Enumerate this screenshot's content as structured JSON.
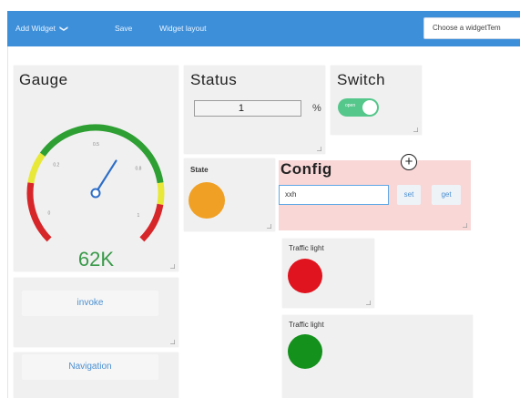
{
  "toolbar": {
    "add_widget_label": "Add Widget",
    "add_widget_chevron": "❯",
    "save_label": "Save",
    "widget_layout_label": "Widget layout",
    "template_placeholder": "Choose a widgetTem"
  },
  "gauge": {
    "title": "Gauge",
    "value_text": "62K",
    "tick_labels": [
      "0",
      "0.2",
      "0.5",
      "0.8",
      "1"
    ],
    "value_fraction": 0.62
  },
  "status": {
    "title": "Status",
    "value": "1",
    "unit": "%"
  },
  "switch": {
    "title": "Switch",
    "state_text": "open",
    "is_on": true
  },
  "state": {
    "title": "State",
    "color": "#f0a024"
  },
  "config": {
    "title": "Config",
    "add_icon": "plus-circle-icon",
    "input_value": "xxh",
    "set_label": "set",
    "get_label": "get"
  },
  "invoke": {
    "label": "invoke"
  },
  "navigation": {
    "label": "Navigation"
  },
  "traffic_light_1": {
    "title": "Traffic light",
    "color": "#e0141e"
  },
  "traffic_light_2": {
    "title": "Traffic light",
    "color": "#14911c"
  },
  "colors": {
    "toolbar": "#3d8fd9",
    "gauge_red": "#d7262a",
    "gauge_yellow": "#e8e838",
    "gauge_green": "#2ea033",
    "needle": "#2e6ec8",
    "gauge_value": "#3a9a4a",
    "config_highlight": "#f9d7d7"
  }
}
